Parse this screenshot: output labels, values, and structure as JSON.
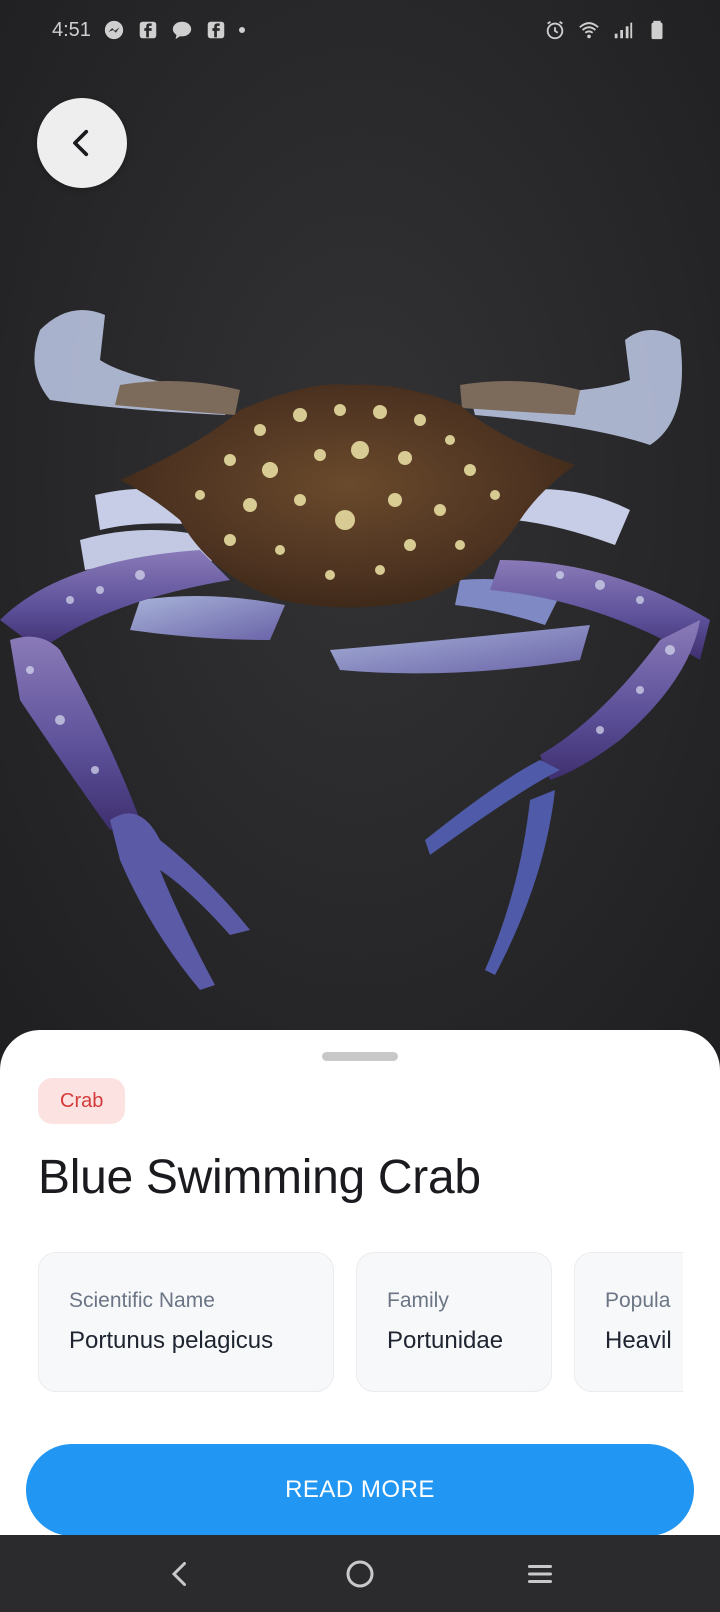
{
  "status_bar": {
    "time": "4:51",
    "left_icons": [
      "messenger-icon",
      "facebook-icon",
      "chat-icon",
      "facebook-icon",
      "dot-icon"
    ],
    "right_icons": [
      "alarm-icon",
      "wifi-icon",
      "signal-icon",
      "battery-icon"
    ]
  },
  "header": {
    "back_icon": "chevron-left-icon"
  },
  "photo": {
    "subject_icon": "crab-photo"
  },
  "detail": {
    "category": "Crab",
    "title": "Blue Swimming Crab",
    "cards": [
      {
        "label": "Scientific Name",
        "value": "Portunus pelagicus"
      },
      {
        "label": "Family",
        "value": "Portunidae"
      },
      {
        "label": "Popula",
        "value": "Heavil"
      }
    ],
    "read_more_label": "READ MORE"
  },
  "colors": {
    "accent": "#2196f3",
    "chip_background": "#fde2e2",
    "chip_text": "#d43b3b"
  },
  "nav_bar": {
    "items": [
      "back-icon",
      "home-icon",
      "recents-icon"
    ]
  }
}
